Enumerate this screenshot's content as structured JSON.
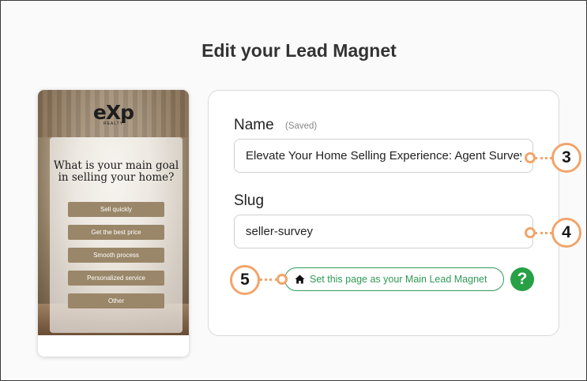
{
  "page": {
    "title": "Edit your Lead Magnet"
  },
  "preview": {
    "logo": "eXp",
    "logo_sub": "REALTY",
    "question": "What is your main goal in selling your home?",
    "options": [
      "Sell quickly",
      "Get the best price",
      "Smooth process",
      "Personalized service",
      "Other"
    ]
  },
  "form": {
    "name_label": "Name",
    "name_status": "(Saved)",
    "name_value": "Elevate Your Home Selling Experience: Agent Survey",
    "slug_label": "Slug",
    "slug_value": "seller-survey",
    "main_button_label": "Set this page as your Main Lead Magnet",
    "main_button_icon": "home-icon",
    "help_label": "?"
  },
  "callouts": {
    "c3": "3",
    "c4": "4",
    "c5": "5"
  },
  "colors": {
    "accent_green": "#2f9a55",
    "callout_orange": "#f2a46a"
  }
}
